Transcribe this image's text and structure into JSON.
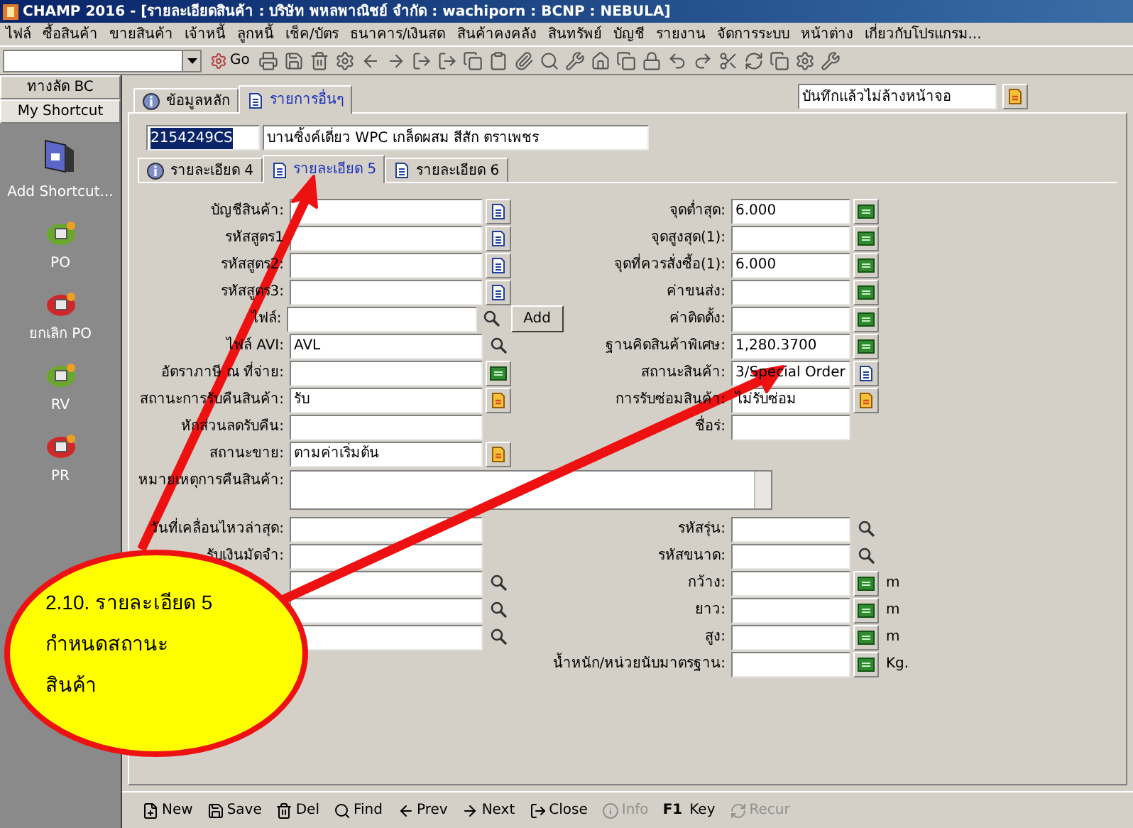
{
  "window": {
    "title": "CHAMP 2016 - [รายละเอียดสินค้า : บริษัท พหลพาณิชย์ จำกัด : wachiporn : BCNP : NEBULA]"
  },
  "menu": [
    "ไฟล์",
    "ซื้อสินค้า",
    "ขายสินค้า",
    "เจ้าหนี้",
    "ลูกหนี้",
    "เช็ค/บัตร",
    "ธนาคาร/เงินสด",
    "สินค้าคงคลัง",
    "สินทรัพย์",
    "บัญชี",
    "รายงาน",
    "จัดการระบบ",
    "หน้าต่าง",
    "เกี่ยวกับโปรแกรม..."
  ],
  "toolbar": {
    "go_label": "Go"
  },
  "sidebar": {
    "tabs": [
      {
        "label": "ทางลัด BC",
        "selected": false
      },
      {
        "label": "My Shortcut",
        "selected": true
      }
    ],
    "items": [
      {
        "label": "Add Shortcut...",
        "kind": "add"
      },
      {
        "label": "PO",
        "kind": "shortcut",
        "color": "#6aa82c"
      },
      {
        "label": "ยกเลิก PO",
        "kind": "shortcut",
        "color": "#d02828"
      },
      {
        "label": "RV",
        "kind": "shortcut",
        "color": "#6aa82c"
      },
      {
        "label": "PR",
        "kind": "shortcut",
        "color": "#d02828"
      }
    ]
  },
  "outer_tabs": [
    {
      "label": "ข้อมูลหลัก",
      "kind": "info",
      "selected": false
    },
    {
      "label": "รายการอื่นๆ",
      "kind": "doc",
      "selected": true
    }
  ],
  "save_mode": {
    "value": "บันทึกแล้วไม่ล้างหน้าจอ"
  },
  "product": {
    "code": "2154249CS",
    "code_selected": true,
    "name": "บานซิ้งค์เดี่ยว WPC เกล็ดผสม สีสัก ตราเพชร"
  },
  "inner_tabs": [
    {
      "label": "รายละเอียด 4",
      "kind": "info",
      "selected": false
    },
    {
      "label": "รายละเอียด 5",
      "kind": "doc",
      "selected": true
    },
    {
      "label": "รายละเอียด 6",
      "kind": "doc",
      "selected": false
    }
  ],
  "left_fields": [
    {
      "label": "บัญชีสินค้า:",
      "kind": "doc"
    },
    {
      "label": "รหัสสูตร1",
      "kind": "doc"
    },
    {
      "label": "รหัสสูตร2:",
      "kind": "doc"
    },
    {
      "label": "รหัสสูตร3:",
      "kind": "doc"
    },
    {
      "label": "ไฟล์:",
      "kind": "search",
      "button": "Add"
    },
    {
      "label": "ไฟล์ AVI:",
      "value": "AVL",
      "kind": "search"
    },
    {
      "label": "อัตราภาษี ณ ที่จ่าย:",
      "kind": "grid"
    },
    {
      "label": "สถานะการรับคืนสินค้า:",
      "value": "รับ",
      "kind": "orange"
    },
    {
      "label": "หักส่วนลดรับคืน:"
    },
    {
      "label": "สถานะขาย:",
      "value": "ตามค่าเริ่มต้น",
      "kind": "orange"
    }
  ],
  "right_fields": [
    {
      "label": "จุดต่ำสุด:",
      "value": "6.000",
      "kind": "grid"
    },
    {
      "label": "จุดสูงสุด(1):",
      "kind": "grid"
    },
    {
      "label": "จุดที่ควรสั่งซื้อ(1):",
      "value": "6.000",
      "kind": "grid"
    },
    {
      "label": "ค่าขนส่ง:",
      "kind": "grid"
    },
    {
      "label": "ค่าติดตั้ง:",
      "kind": "grid"
    },
    {
      "label": "ฐานคิดสินค้าพิเศษ:",
      "value": "1,280.3700",
      "kind": "grid"
    },
    {
      "label": "สถานะสินค้า:",
      "value": "3/Special Order",
      "kind": "doc"
    },
    {
      "label": "การรับซ่อมสินค้า:",
      "value": "ไม่รับซ่อม",
      "kind": "orange"
    },
    {
      "label": "ชื่อร่:"
    }
  ],
  "note": {
    "label": "หมายเหตุการคืนสินค้า:"
  },
  "lower_left_fields": [
    {
      "label": "วันที่เคลื่อนไหวล่าสุด:"
    },
    {
      "label": "รับเงินมัดจำ:"
    },
    {
      "kind": "search"
    },
    {
      "kind": "search"
    },
    {
      "kind": "search"
    }
  ],
  "lower_right_fields": [
    {
      "label": "รหัสรุ่น:",
      "kind": "search"
    },
    {
      "label": "รหัสขนาด:",
      "kind": "search"
    },
    {
      "label": "กว้าง:",
      "kind": "grid",
      "unit": "m"
    },
    {
      "label": "ยาว:",
      "kind": "grid",
      "unit": "m"
    },
    {
      "label": "สูง:",
      "kind": "grid",
      "unit": "m"
    },
    {
      "label": "น้ำหนัก/หน่วยนับมาตรฐาน:",
      "kind": "grid",
      "unit": "Kg."
    }
  ],
  "bottom_bar": [
    {
      "label": "New",
      "disabled": false
    },
    {
      "label": "Save",
      "disabled": false
    },
    {
      "label": "Del",
      "disabled": false
    },
    {
      "label": "Find",
      "disabled": false
    },
    {
      "label": "Prev",
      "disabled": false
    },
    {
      "label": "Next",
      "disabled": false
    },
    {
      "label": "Close",
      "disabled": false
    },
    {
      "label": "Info",
      "disabled": true
    },
    {
      "label": "F1",
      "label2": "Key",
      "disabled": false
    },
    {
      "label": "Recur",
      "disabled": true
    }
  ],
  "callout": {
    "lines": [
      "2.10. รายละเอียด 5",
      "กำหนดสถานะ",
      "สินค้า"
    ]
  }
}
